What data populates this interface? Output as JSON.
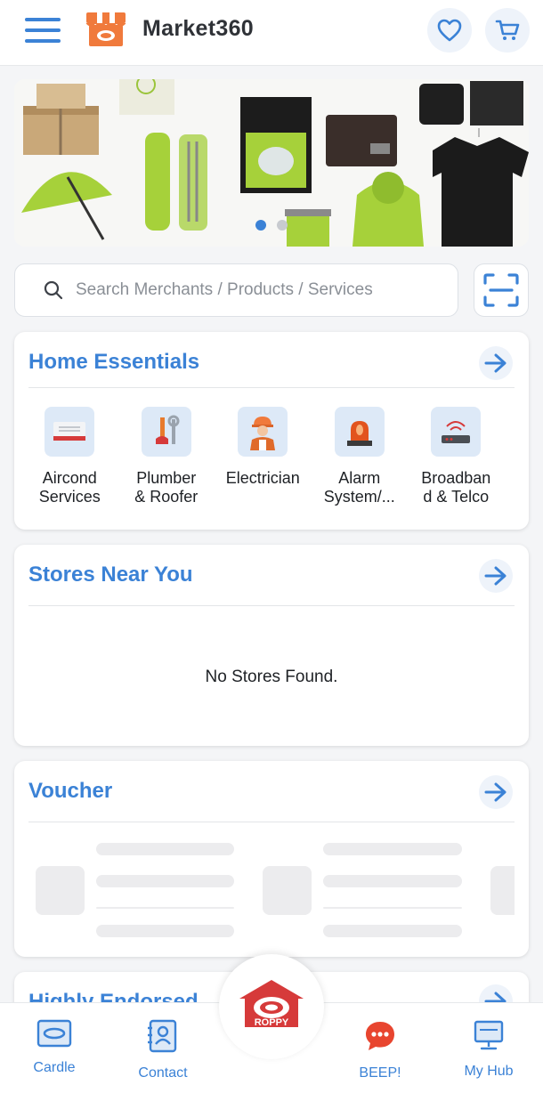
{
  "header": {
    "title": "Market360",
    "menu_icon": "hamburger-menu-icon",
    "logo_icon": "storefront-logo-icon",
    "favorites_icon": "heart-icon",
    "cart_icon": "cart-icon"
  },
  "banner": {
    "slides_total": 2,
    "active_slide": 1
  },
  "search": {
    "placeholder": "Search Merchants / Products / Services",
    "value": "",
    "scan_icon": "scan-icon"
  },
  "home_essentials": {
    "title": "Home Essentials",
    "categories": [
      {
        "label": "Aircond\nServices",
        "icon": "aircond-icon"
      },
      {
        "label": "Plumber\n& Roofer",
        "icon": "plumber-tools-icon"
      },
      {
        "label": "Electrician",
        "icon": "electrician-icon"
      },
      {
        "label": "Alarm\nSystem/...",
        "icon": "alarm-siren-icon"
      },
      {
        "label": "Broadban\nd & Telco",
        "icon": "router-icon"
      }
    ]
  },
  "stores_near_you": {
    "title": "Stores Near You",
    "empty_message": "No Stores Found."
  },
  "voucher": {
    "title": "Voucher"
  },
  "highly_endorsed": {
    "title": "Highly Endorsed"
  },
  "bottom_nav": {
    "items": [
      {
        "label": "Cardle",
        "icon": "card-icon"
      },
      {
        "label": "Contact",
        "icon": "contact-book-icon"
      },
      {
        "label": "BEEP!",
        "icon": "chat-bubble-icon"
      },
      {
        "label": "My Hub",
        "icon": "monitor-icon"
      }
    ],
    "center": {
      "label": "ROPPY",
      "icon": "roppy-house-icon"
    }
  },
  "colors": {
    "accent": "#3b82d6",
    "brand_red": "#d63a3a",
    "brand_orange": "#f07a3c"
  }
}
